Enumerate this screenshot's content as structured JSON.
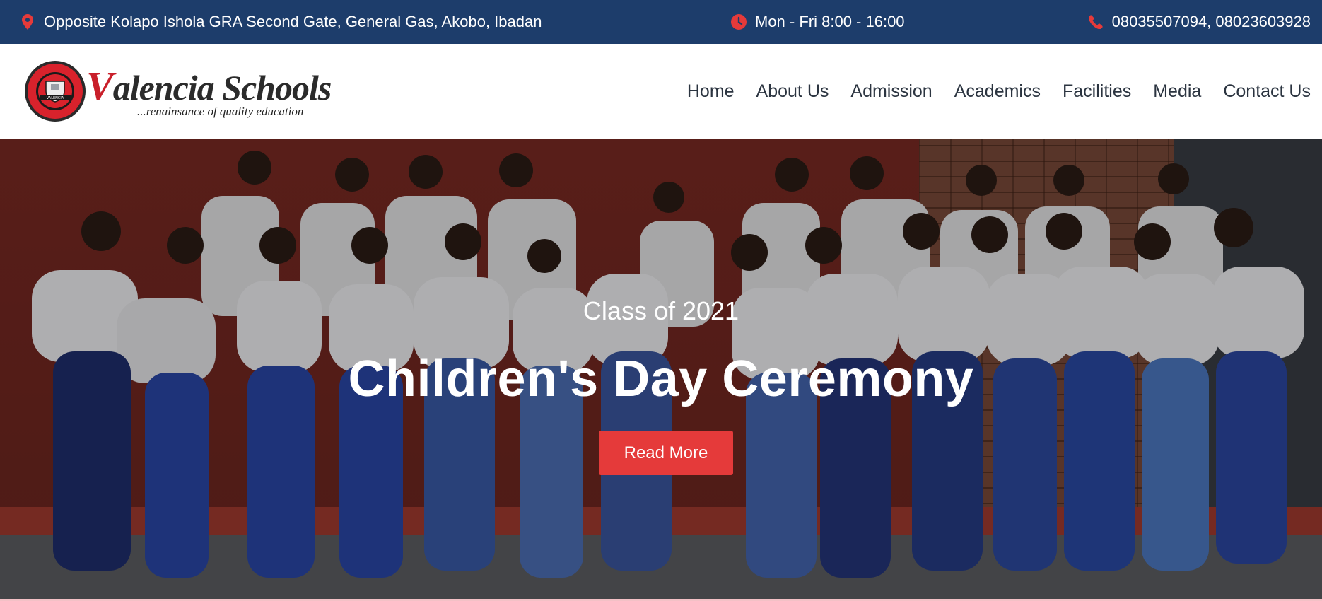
{
  "topbar": {
    "address": "Opposite Kolapo Ishola GRA Second Gate, General Gas, Akobo, Ibadan",
    "address_icon": "map-pin-icon",
    "hours": "Mon - Fri 8:00 - 16:00",
    "hours_icon": "clock-icon",
    "phone": "08035507094, 08023603928",
    "phone_icon": "phone-icon",
    "background_color": "#1d3d6b",
    "icon_color": "#e53a3a"
  },
  "header": {
    "logo": {
      "brand_first_letter": "V",
      "brand_rest": "alencia Schools",
      "tagline": "...renainsance of quality education",
      "seal_text": "VALENCIA COLLEGE AKOBO"
    },
    "nav": [
      {
        "label": "Home"
      },
      {
        "label": "About Us"
      },
      {
        "label": "Admission"
      },
      {
        "label": "Academics"
      },
      {
        "label": "Facilities"
      },
      {
        "label": "Media"
      },
      {
        "label": "Contact Us"
      }
    ]
  },
  "hero": {
    "subtitle": "Class of 2021",
    "title": "Children's Day Ceremony",
    "cta_label": "Read More",
    "cta_color": "#e53a3a"
  }
}
